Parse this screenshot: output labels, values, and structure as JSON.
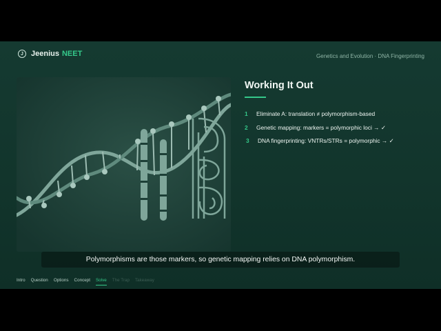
{
  "brand": {
    "name": "Jeenius",
    "accent": "NEET",
    "logo_letter": "J"
  },
  "breadcrumb": "Genetics and Evolution · DNA Fingerprinting",
  "section": {
    "title": "Working It Out"
  },
  "steps": [
    {
      "num": "1",
      "text": "Eliminate A: translation ≠ polymorphism-based"
    },
    {
      "num": "2",
      "text": "Genetic mapping: markers = polymorphic loci → ✓"
    },
    {
      "num": "3",
      "text": "DNA fingerprinting: VNTRs/STRs = polymorphic → ✓"
    }
  ],
  "caption": "Polymorphisms are those markers, so genetic mapping relies on DNA polymorphism.",
  "nav": {
    "items": [
      "Intro",
      "Question",
      "Options",
      "Concept",
      "Solve",
      "The Trap",
      "Takeaway"
    ],
    "active": "Solve"
  },
  "colors": {
    "accent": "#35c98a",
    "background": "#153a31",
    "text": "#eef5f1"
  },
  "illustration": {
    "icons": [
      "dna-helix-icon",
      "chromosome-icon",
      "fingerprint-icon"
    ]
  }
}
